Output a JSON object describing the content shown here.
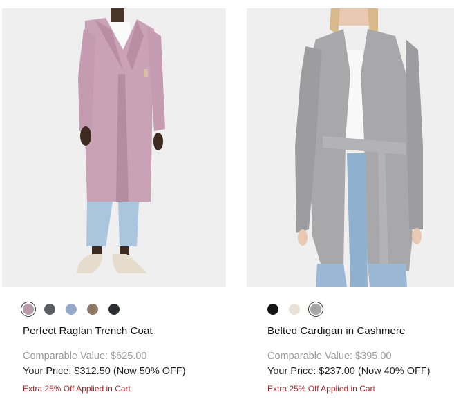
{
  "products": [
    {
      "title": "Perfect Raglan Trench Coat",
      "comparable_value": "Comparable Value: $625.00",
      "your_price": "Your Price: $312.50 (Now 50% OFF)",
      "promo": "Extra 25% Off Applied in Cart",
      "swatches": [
        {
          "color": "#b99aaa",
          "selected": true
        },
        {
          "color": "#5b5b62",
          "selected": false
        },
        {
          "color": "#93a9cc",
          "selected": false
        },
        {
          "color": "#8d7762",
          "selected": false
        },
        {
          "color": "#2a2c33",
          "selected": false
        }
      ],
      "image_icon": "trench-coat-model-image"
    },
    {
      "title": "Belted Cardigan in Cashmere",
      "comparable_value": "Comparable Value: $395.00",
      "your_price": "Your Price: $237.00 (Now 40% OFF)",
      "promo": "Extra 25% Off Applied in Cart",
      "swatches": [
        {
          "color": "#141414",
          "selected": false
        },
        {
          "color": "#eae1d8",
          "selected": false
        },
        {
          "color": "#a6a6a6",
          "selected": true
        }
      ],
      "image_icon": "cardigan-model-image"
    }
  ],
  "colors": {
    "image_bg": "#efefef",
    "promo_red": "#a8252a",
    "muted_text": "#9a9a9a"
  }
}
